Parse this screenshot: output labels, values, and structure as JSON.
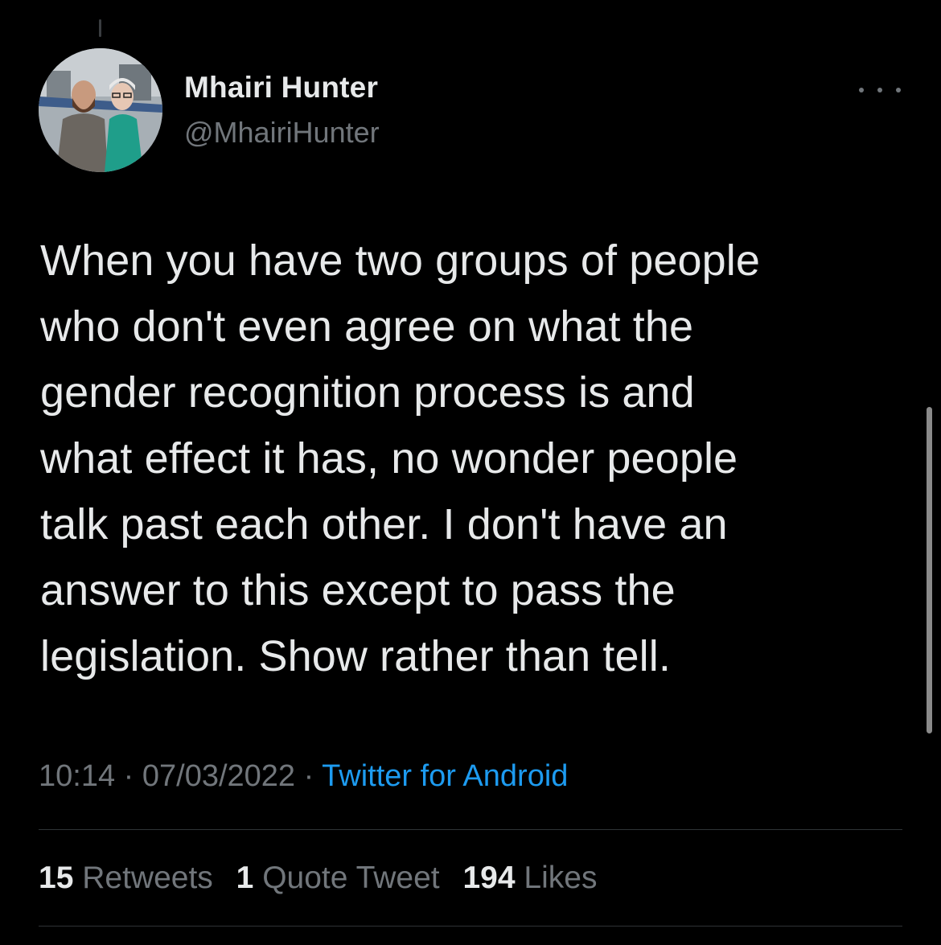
{
  "author": {
    "display_name": "Mhairi Hunter",
    "handle": "@MhairiHunter",
    "avatar_icon": "profile-photo"
  },
  "more_icon": "more-horizontal-icon",
  "tweet": {
    "lines": [
      "When you have two groups of people",
      "who don't even agree on what the",
      "gender recognition process is and",
      "what effect it has, no wonder people",
      "talk past each other. I don't have an",
      "answer to this except to pass the",
      "legislation. Show rather than tell."
    ]
  },
  "meta": {
    "time": "10:14",
    "separator": " · ",
    "date": "07/03/2022",
    "source": "Twitter for Android"
  },
  "stats": {
    "retweets_count": "15",
    "retweets_label": "Retweets",
    "quotes_count": "1",
    "quotes_label": "Quote Tweet",
    "likes_count": "194",
    "likes_label": "Likes"
  },
  "colors": {
    "background": "#000000",
    "text": "#e7e9ea",
    "secondary": "#71767b",
    "link": "#1d9bf0",
    "divider": "#2f3336"
  }
}
